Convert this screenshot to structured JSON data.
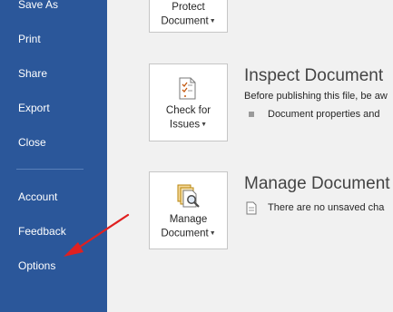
{
  "sidebar": {
    "items": [
      {
        "label": "Save As"
      },
      {
        "label": "Print"
      },
      {
        "label": "Share"
      },
      {
        "label": "Export"
      },
      {
        "label": "Close"
      },
      {
        "label": "Account"
      },
      {
        "label": "Feedback"
      },
      {
        "label": "Options"
      }
    ]
  },
  "protect": {
    "line1": "Protect",
    "line2": "Document"
  },
  "inspect": {
    "tile_line1": "Check for",
    "tile_line2": "Issues",
    "title": "Inspect Document",
    "description": "Before publishing this file, be aw",
    "bullet": "Document properties and"
  },
  "manage": {
    "tile_line1": "Manage",
    "tile_line2": "Document",
    "title": "Manage Document",
    "bullet": "There are no unsaved cha"
  },
  "colors": {
    "sidebar": "#2b579a",
    "annotation_arrow": "#e02020"
  },
  "icons": {
    "caret": "caret-down-icon",
    "inspect": "check-for-issues-icon",
    "manage": "manage-document-icon",
    "bullet_doc": "document-icon",
    "arrow": "annotation-arrow"
  }
}
